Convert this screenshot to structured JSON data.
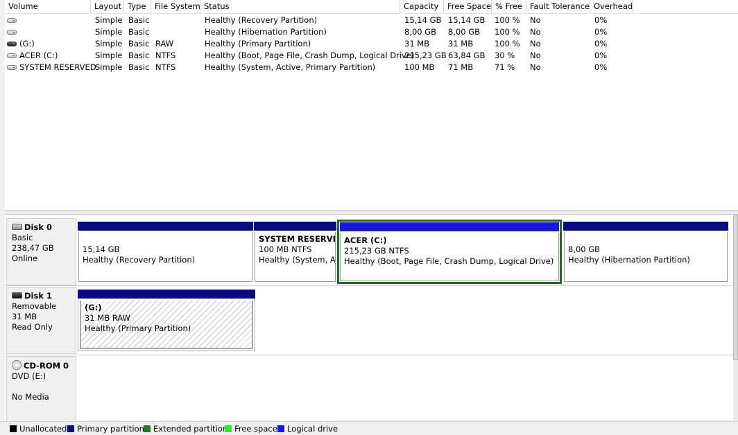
{
  "columns": [
    "Volume",
    "Layout",
    "Type",
    "File System",
    "Status",
    "Capacity",
    "Free Space",
    "% Free",
    "Fault Tolerance",
    "Overhead"
  ],
  "volumes": [
    {
      "icon": "drive-icon",
      "volume": "",
      "layout": "Simple",
      "type": "Basic",
      "fs": "",
      "status": "Healthy (Recovery Partition)",
      "capacity": "15,14 GB",
      "free": "15,14 GB",
      "pct": "100 %",
      "fault": "No",
      "overhead": "0%"
    },
    {
      "icon": "drive-icon",
      "volume": "",
      "layout": "Simple",
      "type": "Basic",
      "fs": "",
      "status": "Healthy (Hibernation Partition)",
      "capacity": "8,00 GB",
      "free": "8,00 GB",
      "pct": "100 %",
      "fault": "No",
      "overhead": "0%"
    },
    {
      "icon": "removable-drive-icon",
      "volume": "(G:)",
      "layout": "Simple",
      "type": "Basic",
      "fs": "RAW",
      "status": "Healthy (Primary Partition)",
      "capacity": "31 MB",
      "free": "31 MB",
      "pct": "100 %",
      "fault": "No",
      "overhead": "0%"
    },
    {
      "icon": "drive-icon",
      "volume": "ACER (C:)",
      "layout": "Simple",
      "type": "Basic",
      "fs": "NTFS",
      "status": "Healthy (Boot, Page File, Crash Dump, Logical Drive)",
      "capacity": "215,23 GB",
      "free": "63,84 GB",
      "pct": "30 %",
      "fault": "No",
      "overhead": "0%"
    },
    {
      "icon": "drive-icon",
      "volume": "SYSTEM RESERVED",
      "layout": "Simple",
      "type": "Basic",
      "fs": "NTFS",
      "status": "Healthy (System, Active, Primary Partition)",
      "capacity": "100 MB",
      "free": "71 MB",
      "pct": "71 %",
      "fault": "No",
      "overhead": "0%"
    }
  ],
  "disks": {
    "disk0": {
      "name": "Disk 0",
      "kind": "Basic",
      "size": "238,47 GB",
      "state": "Online",
      "partitions": [
        {
          "title": "",
          "size": "15,14 GB",
          "status": "Healthy (Recovery Partition)"
        },
        {
          "title": "SYSTEM RESERVED",
          "size": "100 MB NTFS",
          "status": "Healthy (System, Ac"
        },
        {
          "title": "ACER  (C:)",
          "size": "215,23 GB NTFS",
          "status": "Healthy (Boot, Page File, Crash Dump, Logical Drive)"
        },
        {
          "title": "",
          "size": "8,00 GB",
          "status": "Healthy (Hibernation Partition)"
        }
      ]
    },
    "disk1": {
      "name": "Disk 1",
      "kind": "Removable",
      "size": "31 MB",
      "state": "Read Only",
      "partitions": [
        {
          "title": "(G:)",
          "size": "31 MB RAW",
          "status": "Healthy (Primary Partition)"
        }
      ]
    },
    "cdrom0": {
      "name": "CD-ROM 0",
      "kind": "DVD (E:)",
      "state": "No Media"
    }
  },
  "legend": [
    {
      "label": "Unallocated",
      "color": "#000000"
    },
    {
      "label": "Primary partition",
      "color": "#0a0a82"
    },
    {
      "label": "Extended partition",
      "color": "#1a7f1a"
    },
    {
      "label": "Free space",
      "color": "#33e833"
    },
    {
      "label": "Logical drive",
      "color": "#1515e8"
    }
  ]
}
